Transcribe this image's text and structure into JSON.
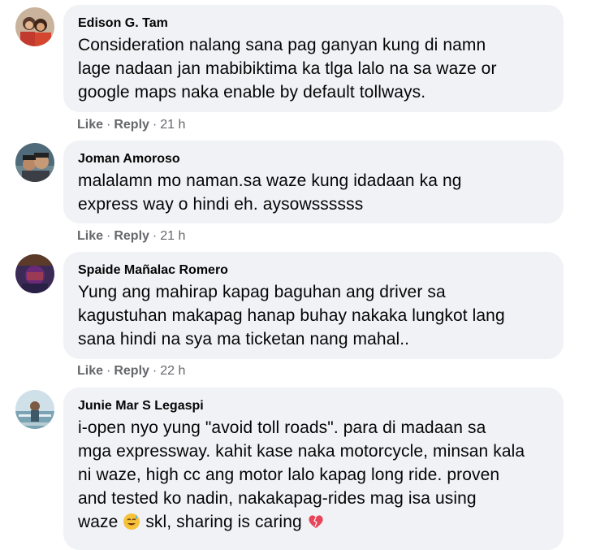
{
  "comments": [
    {
      "author": "Edison G. Tam",
      "text": "Consideration nalang sana pag ganyan kung di namn\nlage nadaan jan mabibiktima ka tlga lalo na sa waze or\ngoogle maps naka enable by default tollways.",
      "like": "Like",
      "reply": "Reply",
      "time": "21 h"
    },
    {
      "author": "Joman Amoroso",
      "text": "malalamn mo naman.sa waze kung idadaan ka ng\nexpress way o hindi eh. aysowssssss",
      "like": "Like",
      "reply": "Reply",
      "time": "21 h"
    },
    {
      "author": "Spaide Mañalac Romero",
      "text": "Yung ang mahirap kapag baguhan ang driver sa\nkagustuhan makapag hanap buhay nakaka lungkot lang\nsana hindi na sya ma ticketan nang mahal..",
      "like": "Like",
      "reply": "Reply",
      "time": "22 h"
    },
    {
      "author": "Junie Mar S Legaspi",
      "text": "i-open nyo yung \"avoid toll roads\". para di madaan sa\nmga expressway. kahit kase naka motorcycle, minsan kala\nni waze, high cc ang motor lalo kapag long ride. proven\nand tested ko nadin, nakakapag-rides mag isa using",
      "last_line_a": "waze",
      "last_line_b": "skl, sharing is caring"
    }
  ],
  "separator": "·",
  "icons": {
    "smile": "smiling-face-with-sweat-icon",
    "heart": "heart-icon"
  }
}
